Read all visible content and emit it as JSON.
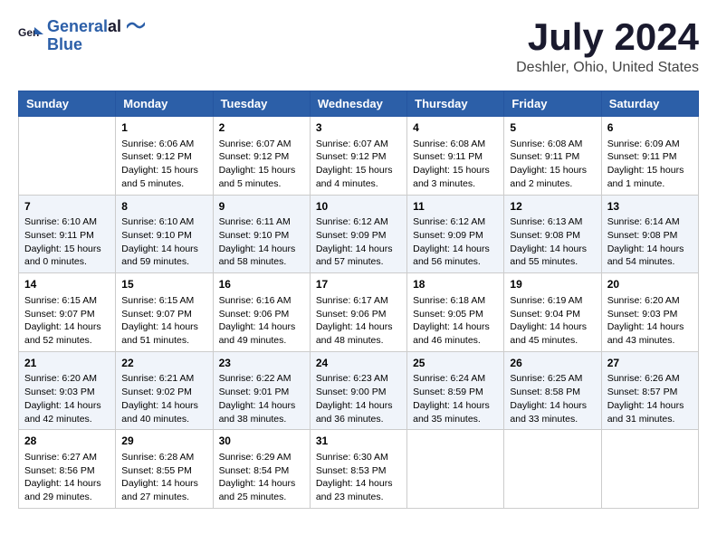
{
  "header": {
    "logo_line1": "General",
    "logo_line2": "Blue",
    "month": "July 2024",
    "location": "Deshler, Ohio, United States"
  },
  "days_of_week": [
    "Sunday",
    "Monday",
    "Tuesday",
    "Wednesday",
    "Thursday",
    "Friday",
    "Saturday"
  ],
  "weeks": [
    [
      {
        "day": "",
        "sunrise": "",
        "sunset": "",
        "daylight": ""
      },
      {
        "day": "1",
        "sunrise": "Sunrise: 6:06 AM",
        "sunset": "Sunset: 9:12 PM",
        "daylight": "Daylight: 15 hours and 5 minutes."
      },
      {
        "day": "2",
        "sunrise": "Sunrise: 6:07 AM",
        "sunset": "Sunset: 9:12 PM",
        "daylight": "Daylight: 15 hours and 5 minutes."
      },
      {
        "day": "3",
        "sunrise": "Sunrise: 6:07 AM",
        "sunset": "Sunset: 9:12 PM",
        "daylight": "Daylight: 15 hours and 4 minutes."
      },
      {
        "day": "4",
        "sunrise": "Sunrise: 6:08 AM",
        "sunset": "Sunset: 9:11 PM",
        "daylight": "Daylight: 15 hours and 3 minutes."
      },
      {
        "day": "5",
        "sunrise": "Sunrise: 6:08 AM",
        "sunset": "Sunset: 9:11 PM",
        "daylight": "Daylight: 15 hours and 2 minutes."
      },
      {
        "day": "6",
        "sunrise": "Sunrise: 6:09 AM",
        "sunset": "Sunset: 9:11 PM",
        "daylight": "Daylight: 15 hours and 1 minute."
      }
    ],
    [
      {
        "day": "7",
        "sunrise": "Sunrise: 6:10 AM",
        "sunset": "Sunset: 9:11 PM",
        "daylight": "Daylight: 15 hours and 0 minutes."
      },
      {
        "day": "8",
        "sunrise": "Sunrise: 6:10 AM",
        "sunset": "Sunset: 9:10 PM",
        "daylight": "Daylight: 14 hours and 59 minutes."
      },
      {
        "day": "9",
        "sunrise": "Sunrise: 6:11 AM",
        "sunset": "Sunset: 9:10 PM",
        "daylight": "Daylight: 14 hours and 58 minutes."
      },
      {
        "day": "10",
        "sunrise": "Sunrise: 6:12 AM",
        "sunset": "Sunset: 9:09 PM",
        "daylight": "Daylight: 14 hours and 57 minutes."
      },
      {
        "day": "11",
        "sunrise": "Sunrise: 6:12 AM",
        "sunset": "Sunset: 9:09 PM",
        "daylight": "Daylight: 14 hours and 56 minutes."
      },
      {
        "day": "12",
        "sunrise": "Sunrise: 6:13 AM",
        "sunset": "Sunset: 9:08 PM",
        "daylight": "Daylight: 14 hours and 55 minutes."
      },
      {
        "day": "13",
        "sunrise": "Sunrise: 6:14 AM",
        "sunset": "Sunset: 9:08 PM",
        "daylight": "Daylight: 14 hours and 54 minutes."
      }
    ],
    [
      {
        "day": "14",
        "sunrise": "Sunrise: 6:15 AM",
        "sunset": "Sunset: 9:07 PM",
        "daylight": "Daylight: 14 hours and 52 minutes."
      },
      {
        "day": "15",
        "sunrise": "Sunrise: 6:15 AM",
        "sunset": "Sunset: 9:07 PM",
        "daylight": "Daylight: 14 hours and 51 minutes."
      },
      {
        "day": "16",
        "sunrise": "Sunrise: 6:16 AM",
        "sunset": "Sunset: 9:06 PM",
        "daylight": "Daylight: 14 hours and 49 minutes."
      },
      {
        "day": "17",
        "sunrise": "Sunrise: 6:17 AM",
        "sunset": "Sunset: 9:06 PM",
        "daylight": "Daylight: 14 hours and 48 minutes."
      },
      {
        "day": "18",
        "sunrise": "Sunrise: 6:18 AM",
        "sunset": "Sunset: 9:05 PM",
        "daylight": "Daylight: 14 hours and 46 minutes."
      },
      {
        "day": "19",
        "sunrise": "Sunrise: 6:19 AM",
        "sunset": "Sunset: 9:04 PM",
        "daylight": "Daylight: 14 hours and 45 minutes."
      },
      {
        "day": "20",
        "sunrise": "Sunrise: 6:20 AM",
        "sunset": "Sunset: 9:03 PM",
        "daylight": "Daylight: 14 hours and 43 minutes."
      }
    ],
    [
      {
        "day": "21",
        "sunrise": "Sunrise: 6:20 AM",
        "sunset": "Sunset: 9:03 PM",
        "daylight": "Daylight: 14 hours and 42 minutes."
      },
      {
        "day": "22",
        "sunrise": "Sunrise: 6:21 AM",
        "sunset": "Sunset: 9:02 PM",
        "daylight": "Daylight: 14 hours and 40 minutes."
      },
      {
        "day": "23",
        "sunrise": "Sunrise: 6:22 AM",
        "sunset": "Sunset: 9:01 PM",
        "daylight": "Daylight: 14 hours and 38 minutes."
      },
      {
        "day": "24",
        "sunrise": "Sunrise: 6:23 AM",
        "sunset": "Sunset: 9:00 PM",
        "daylight": "Daylight: 14 hours and 36 minutes."
      },
      {
        "day": "25",
        "sunrise": "Sunrise: 6:24 AM",
        "sunset": "Sunset: 8:59 PM",
        "daylight": "Daylight: 14 hours and 35 minutes."
      },
      {
        "day": "26",
        "sunrise": "Sunrise: 6:25 AM",
        "sunset": "Sunset: 8:58 PM",
        "daylight": "Daylight: 14 hours and 33 minutes."
      },
      {
        "day": "27",
        "sunrise": "Sunrise: 6:26 AM",
        "sunset": "Sunset: 8:57 PM",
        "daylight": "Daylight: 14 hours and 31 minutes."
      }
    ],
    [
      {
        "day": "28",
        "sunrise": "Sunrise: 6:27 AM",
        "sunset": "Sunset: 8:56 PM",
        "daylight": "Daylight: 14 hours and 29 minutes."
      },
      {
        "day": "29",
        "sunrise": "Sunrise: 6:28 AM",
        "sunset": "Sunset: 8:55 PM",
        "daylight": "Daylight: 14 hours and 27 minutes."
      },
      {
        "day": "30",
        "sunrise": "Sunrise: 6:29 AM",
        "sunset": "Sunset: 8:54 PM",
        "daylight": "Daylight: 14 hours and 25 minutes."
      },
      {
        "day": "31",
        "sunrise": "Sunrise: 6:30 AM",
        "sunset": "Sunset: 8:53 PM",
        "daylight": "Daylight: 14 hours and 23 minutes."
      },
      {
        "day": "",
        "sunrise": "",
        "sunset": "",
        "daylight": ""
      },
      {
        "day": "",
        "sunrise": "",
        "sunset": "",
        "daylight": ""
      },
      {
        "day": "",
        "sunrise": "",
        "sunset": "",
        "daylight": ""
      }
    ]
  ]
}
